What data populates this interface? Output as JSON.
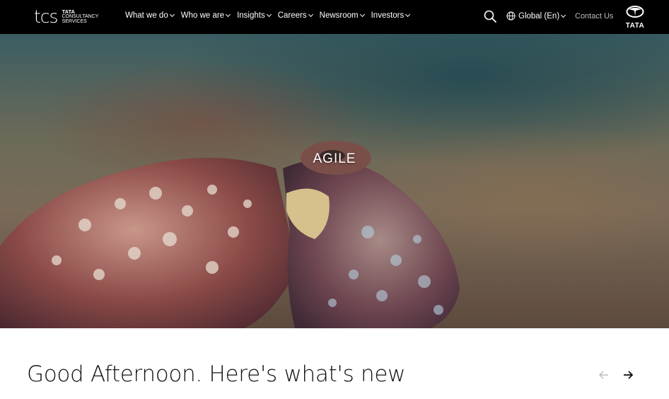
{
  "header": {
    "logo": {
      "mark": "tcs",
      "line1": "TATA",
      "line2": "CONSULTANCY",
      "line3": "SERVICES"
    },
    "nav": [
      {
        "label": "What we do"
      },
      {
        "label": "Who we are"
      },
      {
        "label": "Insights"
      },
      {
        "label": "Careers"
      },
      {
        "label": "Newsroom"
      },
      {
        "label": "Investors"
      }
    ],
    "region": "Global (En)",
    "contact": "Contact Us",
    "brand_word": "TATA",
    "icons": {
      "search": "search-icon",
      "globe": "globe-icon",
      "chevron": "chevron-down-icon"
    }
  },
  "hero": {
    "word": "AGILE",
    "image": "octopus-underwater"
  },
  "main": {
    "greeting": "Good Afternoon. Here's what's new",
    "carousel": {
      "prev_icon": "arrow-left-icon",
      "next_icon": "arrow-right-icon"
    }
  },
  "colors": {
    "header_bg": "#000000",
    "header_text": "#ffffff",
    "contact_text": "#bdbdbd",
    "body_bg": "#ffffff",
    "greeting_text": "#111111",
    "arrow_disabled": "#bbbbbb"
  }
}
